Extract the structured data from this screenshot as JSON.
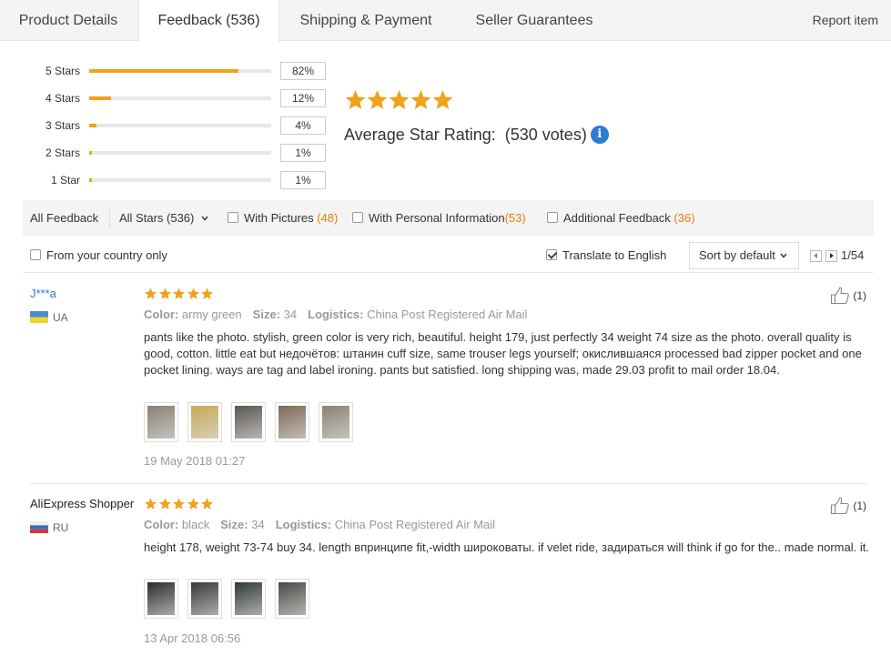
{
  "tabs": {
    "items": [
      {
        "label": "Product Details"
      },
      {
        "label": "Feedback (536)"
      },
      {
        "label": "Shipping & Payment"
      },
      {
        "label": "Seller Guarantees"
      }
    ],
    "report_label": "Report item"
  },
  "rating_summary": {
    "histogram": [
      {
        "label": "5 Stars",
        "percent_text": "82%",
        "fraction": 0.82
      },
      {
        "label": "4 Stars",
        "percent_text": "12%",
        "fraction": 0.12
      },
      {
        "label": "3 Stars",
        "percent_text": "4%",
        "fraction": 0.04
      },
      {
        "label": "2 Stars",
        "percent_text": "1%",
        "fraction": 0.01
      },
      {
        "label": "1 Star",
        "percent_text": "1%",
        "fraction": 0.01
      }
    ],
    "average_label": "Average Star Rating:",
    "votes": "(530 votes)",
    "info_icon": "i",
    "stars_shown": 5
  },
  "filters": {
    "all_feedback": "All Feedback",
    "all_stars": "All Stars (536)",
    "with_pictures": {
      "label": "With Pictures",
      "count": "(48)",
      "checked": false
    },
    "with_personal": {
      "label": "With Personal Information",
      "count": "(53)",
      "checked": false
    },
    "additional": {
      "label": "Additional Feedback",
      "count": "(36)",
      "checked": false
    }
  },
  "toolbar": {
    "country_only": {
      "label": "From your country only",
      "checked": false
    },
    "translate": {
      "label": "Translate to English",
      "checked": true
    },
    "sort_label": "Sort by default",
    "page_indicator": "1/54"
  },
  "reviews": [
    {
      "name": "J***a",
      "country": "UA",
      "rating": 5,
      "color_label": "Color:",
      "color": "army green",
      "size_label": "Size:",
      "size": "34",
      "logistics_label": "Logistics:",
      "logistics": "China Post Registered Air Mail",
      "text": "pants like the photo. stylish, green color is very rich, beautiful. height 179, just perfectly 34 weight 74 size as the photo. overall quality is good, cotton. little eat but недочётов: штанин cuff size, same trouser legs yourself; окислившаяся processed bad zipper pocket and one pocket lining. ways are tag and label ironing. pants but satisfied. long shipping was, made 29.03 profit to mail order 18.04.",
      "images": [
        "#8a7f72",
        "#c9a95a",
        "#5a5652",
        "#7d6a55",
        "#8c8170"
      ],
      "date": "19 May 2018 01:27",
      "helpful": "(1)"
    },
    {
      "name": "AliExpress Shopper",
      "country": "RU",
      "rating": 5,
      "color_label": "Color:",
      "color": "black",
      "size_label": "Size:",
      "size": "34",
      "logistics_label": "Logistics:",
      "logistics": "China Post Registered Air Mail",
      "text": "height 178, weight 73-74 buy 34. length впринципе fit,-width широковаты. if velet ride, задираться will think if go for the.. made normal. it.",
      "images": [
        "#2e2c2b",
        "#3a3734",
        "#2f3a33",
        "#4b4a45"
      ],
      "date": "13 Apr 2018 06:56",
      "helpful": "(1)"
    }
  ],
  "colors": {
    "star": "#f0a21b",
    "link": "#2d7bd2",
    "count": "#e57e0c"
  }
}
